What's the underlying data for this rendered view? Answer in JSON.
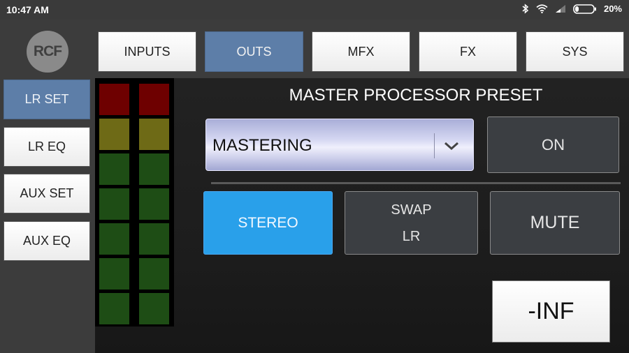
{
  "status_bar": {
    "time": "10:47 AM",
    "battery_percent": "20%",
    "battery_level": 0.2
  },
  "app": {
    "logo_text": "RCF",
    "tabs": [
      {
        "label": "INPUTS",
        "active": false
      },
      {
        "label": "OUTS",
        "active": true
      },
      {
        "label": "MFX",
        "active": false
      },
      {
        "label": "FX",
        "active": false
      },
      {
        "label": "SYS",
        "active": false
      }
    ],
    "side_menu": [
      {
        "label": "LR SET",
        "active": true
      },
      {
        "label": "LR EQ",
        "active": false
      },
      {
        "label": "AUX SET",
        "active": false
      },
      {
        "label": "AUX EQ",
        "active": false
      }
    ],
    "accent_color": "#5d7ea8"
  },
  "meters": {
    "channels": 2,
    "segments_top_to_bottom": [
      "#6e0000",
      "#6e6a16",
      "#1e4d15",
      "#1e4d15",
      "#1e4d15",
      "#1e4d15",
      "#1e4d15"
    ]
  },
  "main": {
    "title": "MASTER PROCESSOR PRESET",
    "preset_value": "MASTERING",
    "on_label": "ON",
    "stereo_label": "STEREO",
    "swap_label_line1": "SWAP",
    "swap_label_line2": "LR",
    "mute_label": "MUTE",
    "level_value": "-INF"
  }
}
